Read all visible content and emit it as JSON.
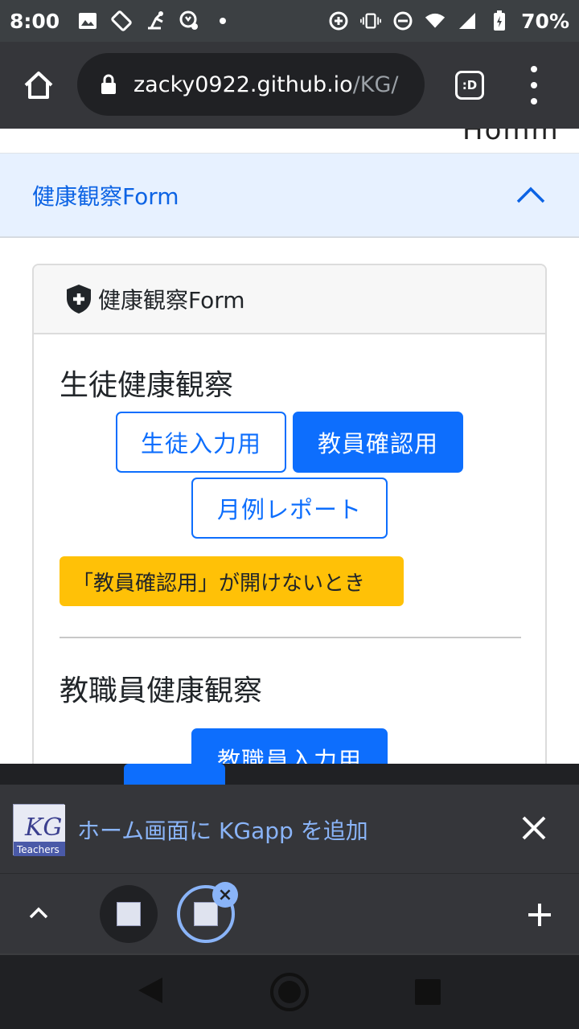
{
  "status_bar": {
    "time": "8:00",
    "battery": "70%",
    "icons": [
      "image-icon",
      "rotate-icon",
      "dj-icon",
      "crown-icon",
      "dot-icon",
      "data-saver-icon",
      "vibrate-icon",
      "dnd-icon",
      "wifi-icon",
      "signal-icon",
      "battery-icon"
    ]
  },
  "browser": {
    "url_host": "zacky0922.github.io",
    "url_path": "/KG/",
    "tabs_label": ":D"
  },
  "page": {
    "cut_text": "Homm",
    "accordion": {
      "label": "健康観察Form"
    },
    "card": {
      "header_title": "健康観察Form",
      "student_section": {
        "title": "生徒健康観察",
        "buttons": {
          "student_input": "生徒入力用",
          "teacher_check": "教員確認用",
          "monthly_report": "月例レポート"
        },
        "warning_button": "「教員確認用」が開けないとき"
      },
      "staff_section": {
        "title": "教職員健康観察",
        "button": "教職員入力用"
      }
    }
  },
  "install_banner": {
    "text": "ホーム画面に KGapp を追加",
    "logo_text": "Teachers"
  },
  "colors": {
    "primary": "#0d6efd",
    "warning": "#ffc107",
    "accordion_bg": "#e7f1ff",
    "link": "#8ab4f8"
  }
}
